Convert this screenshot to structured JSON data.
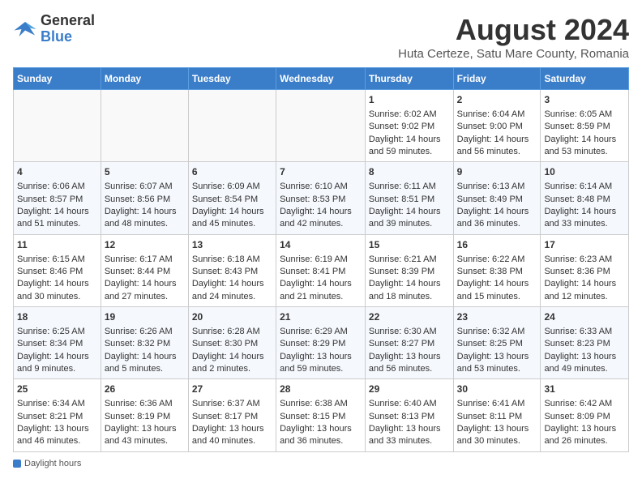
{
  "header": {
    "logo_general": "General",
    "logo_blue": "Blue",
    "month_title": "August 2024",
    "subtitle": "Huta Certeze, Satu Mare County, Romania"
  },
  "days_of_week": [
    "Sunday",
    "Monday",
    "Tuesday",
    "Wednesday",
    "Thursday",
    "Friday",
    "Saturday"
  ],
  "weeks": [
    [
      {
        "day": "",
        "data": ""
      },
      {
        "day": "",
        "data": ""
      },
      {
        "day": "",
        "data": ""
      },
      {
        "day": "",
        "data": ""
      },
      {
        "day": "1",
        "data": "Sunrise: 6:02 AM\nSunset: 9:02 PM\nDaylight: 14 hours and 59 minutes."
      },
      {
        "day": "2",
        "data": "Sunrise: 6:04 AM\nSunset: 9:00 PM\nDaylight: 14 hours and 56 minutes."
      },
      {
        "day": "3",
        "data": "Sunrise: 6:05 AM\nSunset: 8:59 PM\nDaylight: 14 hours and 53 minutes."
      }
    ],
    [
      {
        "day": "4",
        "data": "Sunrise: 6:06 AM\nSunset: 8:57 PM\nDaylight: 14 hours and 51 minutes."
      },
      {
        "day": "5",
        "data": "Sunrise: 6:07 AM\nSunset: 8:56 PM\nDaylight: 14 hours and 48 minutes."
      },
      {
        "day": "6",
        "data": "Sunrise: 6:09 AM\nSunset: 8:54 PM\nDaylight: 14 hours and 45 minutes."
      },
      {
        "day": "7",
        "data": "Sunrise: 6:10 AM\nSunset: 8:53 PM\nDaylight: 14 hours and 42 minutes."
      },
      {
        "day": "8",
        "data": "Sunrise: 6:11 AM\nSunset: 8:51 PM\nDaylight: 14 hours and 39 minutes."
      },
      {
        "day": "9",
        "data": "Sunrise: 6:13 AM\nSunset: 8:49 PM\nDaylight: 14 hours and 36 minutes."
      },
      {
        "day": "10",
        "data": "Sunrise: 6:14 AM\nSunset: 8:48 PM\nDaylight: 14 hours and 33 minutes."
      }
    ],
    [
      {
        "day": "11",
        "data": "Sunrise: 6:15 AM\nSunset: 8:46 PM\nDaylight: 14 hours and 30 minutes."
      },
      {
        "day": "12",
        "data": "Sunrise: 6:17 AM\nSunset: 8:44 PM\nDaylight: 14 hours and 27 minutes."
      },
      {
        "day": "13",
        "data": "Sunrise: 6:18 AM\nSunset: 8:43 PM\nDaylight: 14 hours and 24 minutes."
      },
      {
        "day": "14",
        "data": "Sunrise: 6:19 AM\nSunset: 8:41 PM\nDaylight: 14 hours and 21 minutes."
      },
      {
        "day": "15",
        "data": "Sunrise: 6:21 AM\nSunset: 8:39 PM\nDaylight: 14 hours and 18 minutes."
      },
      {
        "day": "16",
        "data": "Sunrise: 6:22 AM\nSunset: 8:38 PM\nDaylight: 14 hours and 15 minutes."
      },
      {
        "day": "17",
        "data": "Sunrise: 6:23 AM\nSunset: 8:36 PM\nDaylight: 14 hours and 12 minutes."
      }
    ],
    [
      {
        "day": "18",
        "data": "Sunrise: 6:25 AM\nSunset: 8:34 PM\nDaylight: 14 hours and 9 minutes."
      },
      {
        "day": "19",
        "data": "Sunrise: 6:26 AM\nSunset: 8:32 PM\nDaylight: 14 hours and 5 minutes."
      },
      {
        "day": "20",
        "data": "Sunrise: 6:28 AM\nSunset: 8:30 PM\nDaylight: 14 hours and 2 minutes."
      },
      {
        "day": "21",
        "data": "Sunrise: 6:29 AM\nSunset: 8:29 PM\nDaylight: 13 hours and 59 minutes."
      },
      {
        "day": "22",
        "data": "Sunrise: 6:30 AM\nSunset: 8:27 PM\nDaylight: 13 hours and 56 minutes."
      },
      {
        "day": "23",
        "data": "Sunrise: 6:32 AM\nSunset: 8:25 PM\nDaylight: 13 hours and 53 minutes."
      },
      {
        "day": "24",
        "data": "Sunrise: 6:33 AM\nSunset: 8:23 PM\nDaylight: 13 hours and 49 minutes."
      }
    ],
    [
      {
        "day": "25",
        "data": "Sunrise: 6:34 AM\nSunset: 8:21 PM\nDaylight: 13 hours and 46 minutes."
      },
      {
        "day": "26",
        "data": "Sunrise: 6:36 AM\nSunset: 8:19 PM\nDaylight: 13 hours and 43 minutes."
      },
      {
        "day": "27",
        "data": "Sunrise: 6:37 AM\nSunset: 8:17 PM\nDaylight: 13 hours and 40 minutes."
      },
      {
        "day": "28",
        "data": "Sunrise: 6:38 AM\nSunset: 8:15 PM\nDaylight: 13 hours and 36 minutes."
      },
      {
        "day": "29",
        "data": "Sunrise: 6:40 AM\nSunset: 8:13 PM\nDaylight: 13 hours and 33 minutes."
      },
      {
        "day": "30",
        "data": "Sunrise: 6:41 AM\nSunset: 8:11 PM\nDaylight: 13 hours and 30 minutes."
      },
      {
        "day": "31",
        "data": "Sunrise: 6:42 AM\nSunset: 8:09 PM\nDaylight: 13 hours and 26 minutes."
      }
    ]
  ],
  "footer": {
    "label": "Daylight hours"
  }
}
